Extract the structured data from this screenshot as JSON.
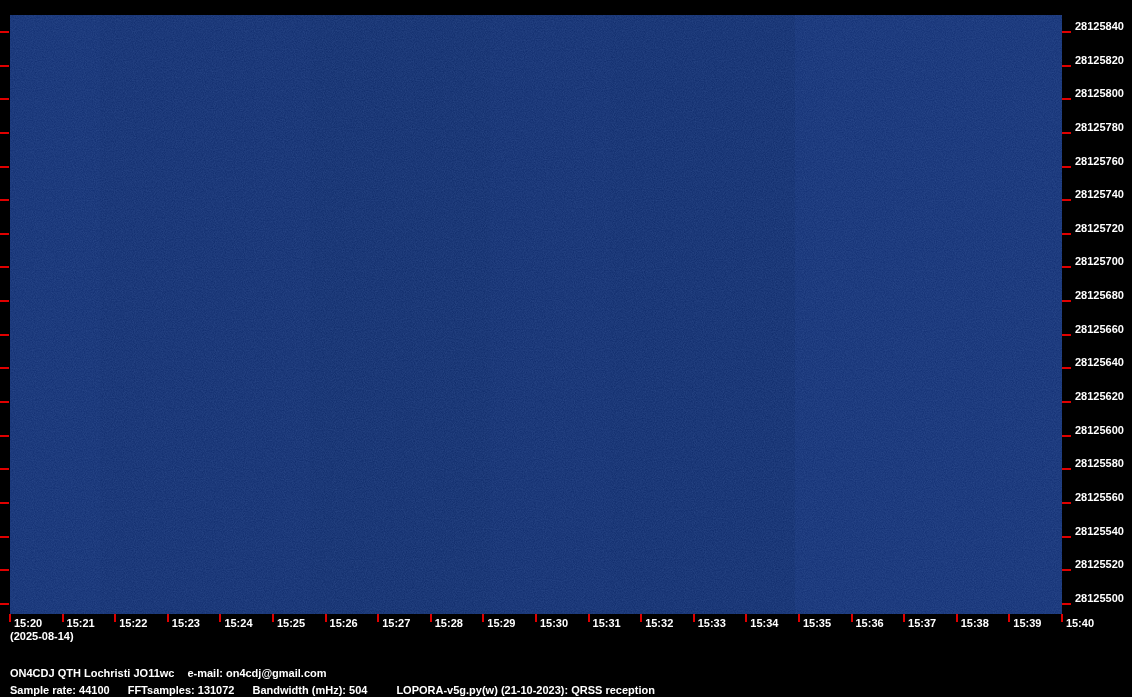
{
  "frequency_axis": {
    "labels": [
      "28125840",
      "28125820",
      "28125800",
      "28125780",
      "28125760",
      "28125740",
      "28125720",
      "28125700",
      "28125680",
      "28125660",
      "28125640",
      "28125620",
      "28125600",
      "28125580",
      "28125560",
      "28125540",
      "28125520",
      "28125500"
    ]
  },
  "time_axis": {
    "labels": [
      "15:20",
      "15:21",
      "15:22",
      "15:23",
      "15:24",
      "15:25",
      "15:26",
      "15:27",
      "15:28",
      "15:29",
      "15:30",
      "15:31",
      "15:32",
      "15:33",
      "15:34",
      "15:35",
      "15:36",
      "15:37",
      "15:38",
      "15:39",
      "15:40"
    ],
    "date": "(2025-08-14)"
  },
  "footer": {
    "line_1": [
      "ON4CDJ QTH Lochristi JO11wc",
      "e-mail: on4cdj@gmail.com"
    ],
    "line_2": [
      "Sample rate: 44100",
      "FFTsamples: 131072",
      "Bandwidth (mHz): 504",
      "LOPORA-v5g.py(w) (21-10-2023): QRSS reception"
    ]
  }
}
